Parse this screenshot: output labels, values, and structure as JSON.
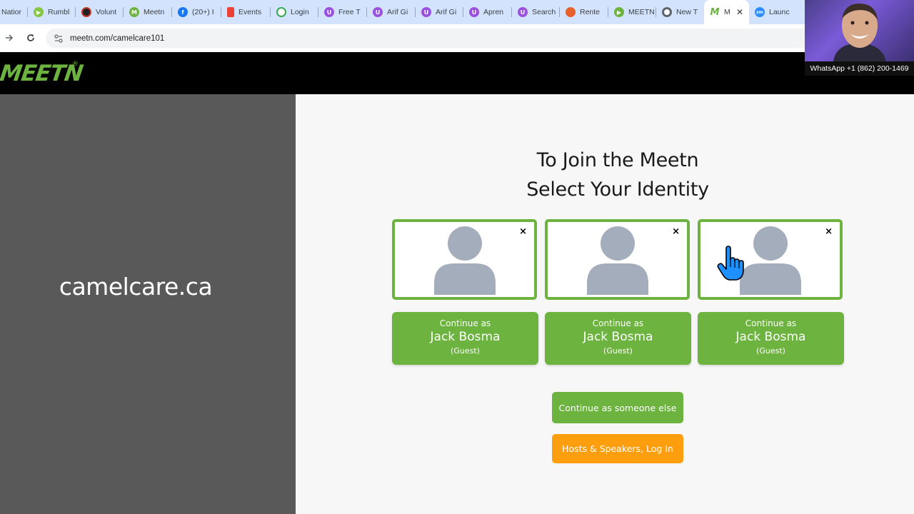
{
  "browser": {
    "tabs": [
      {
        "label": "Natior",
        "icon": "globe-icon",
        "color": "#5f6368"
      },
      {
        "label": "Rumbl",
        "icon": "rumble-icon",
        "color": "#85c742"
      },
      {
        "label": "Volunt",
        "icon": "volunteer-icon",
        "color": "#222222"
      },
      {
        "label": "Meetn",
        "icon": "meetn-icon",
        "color": "#6db33f"
      },
      {
        "label": "(20+) I",
        "icon": "facebook-icon",
        "color": "#1877f2"
      },
      {
        "label": "Events",
        "icon": "events-icon",
        "color": "#ea4335"
      },
      {
        "label": "Login",
        "icon": "login-icon",
        "color": "#34a853"
      },
      {
        "label": "Free T",
        "icon": "u-icon",
        "color": "#9b51e0"
      },
      {
        "label": "Arif Gi",
        "icon": "u-icon",
        "color": "#9b51e0"
      },
      {
        "label": "Arif Gi",
        "icon": "u-icon",
        "color": "#9b51e0"
      },
      {
        "label": "Apren",
        "icon": "u-icon",
        "color": "#9b51e0"
      },
      {
        "label": "Search",
        "icon": "u-icon",
        "color": "#9b51e0"
      },
      {
        "label": "Rente",
        "icon": "rente-icon",
        "color": "#e8602c"
      },
      {
        "label": "MEETN",
        "icon": "play-icon",
        "color": "#6db33f"
      },
      {
        "label": "New T",
        "icon": "chrome-icon",
        "color": "#5f6368"
      },
      {
        "label": "M",
        "icon": "meetn-m-icon",
        "color": "#6db33f",
        "active": true
      },
      {
        "label": "Launc",
        "icon": "zoom-icon",
        "color": "#2d8cff"
      }
    ],
    "url": "meetn.com/camelcare101"
  },
  "header": {
    "logo_text": "MEETN",
    "logo_reg": "®"
  },
  "left": {
    "org_name": "camelcare.ca"
  },
  "main": {
    "title_line1": "To Join the Meetn",
    "title_line2": "Select Your Identity",
    "identities": [
      {
        "line1": "Continue as",
        "name": "Jack Bosma",
        "role": "(Guest)",
        "remove": "×"
      },
      {
        "line1": "Continue as",
        "name": "Jack Bosma",
        "role": "(Guest)",
        "remove": "×"
      },
      {
        "line1": "Continue as",
        "name": "Jack Bosma",
        "role": "(Guest)",
        "remove": "×"
      }
    ],
    "someone_else_label": "Continue as someone else",
    "host_login_label": "Hosts & Speakers, Log In"
  },
  "webcam": {
    "caption": "WhatsApp  +1 (862) 200-1469"
  },
  "colors": {
    "brand_green": "#6db33f",
    "host_orange": "#fd9e0f",
    "left_panel": "#595959",
    "avatar_gray": "#a3adbb"
  }
}
